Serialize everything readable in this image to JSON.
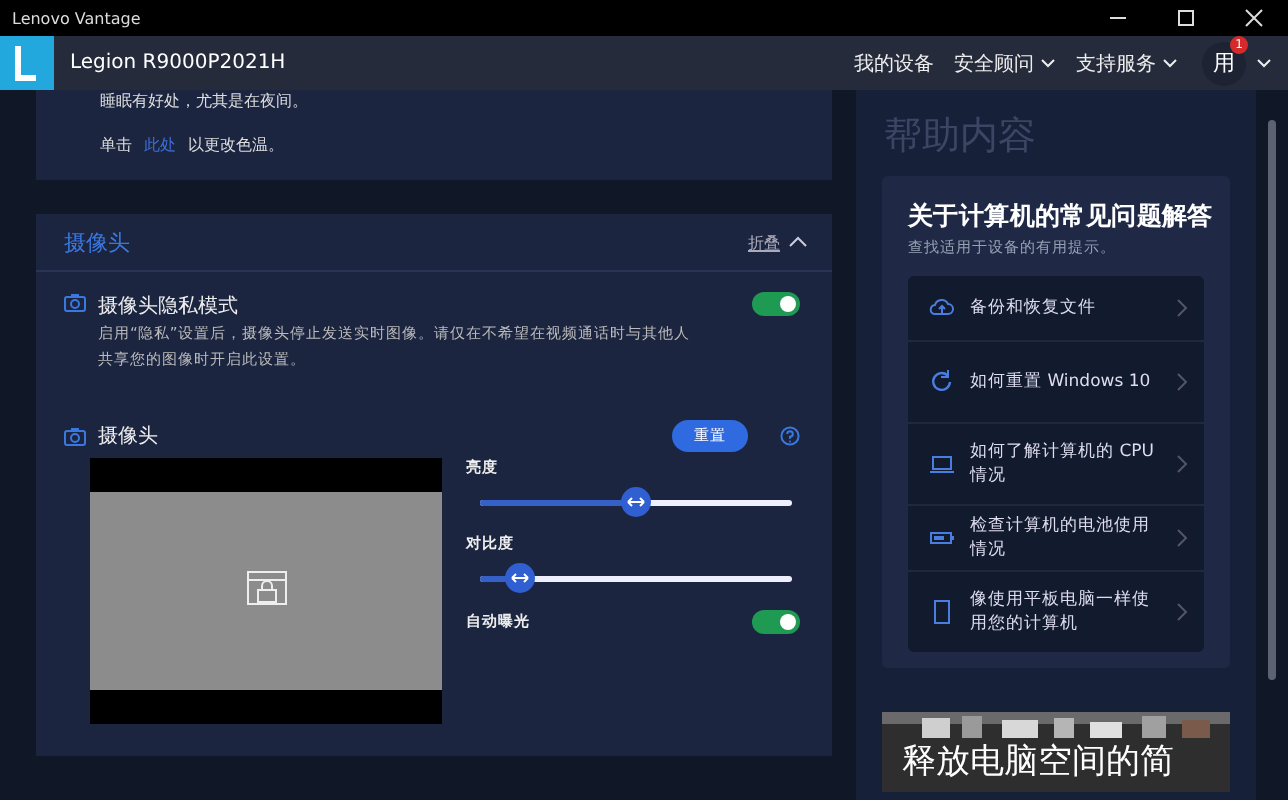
{
  "window": {
    "title": "Lenovo Vantage"
  },
  "header": {
    "device": "Legion R9000P2021H",
    "nav": [
      {
        "label": "我的设备",
        "dropdown": false
      },
      {
        "label": "安全顾问",
        "dropdown": true
      },
      {
        "label": "支持服务",
        "dropdown": true
      }
    ],
    "user": {
      "initial": "用",
      "badge": "1"
    }
  },
  "display_card": {
    "text": "睡眠有好处，尤其是在夜间。",
    "click_prefix": "单击",
    "link": "此处",
    "click_suffix": "以更改色温。"
  },
  "camera_card": {
    "title": "摄像头",
    "collapse": "折叠",
    "privacy": {
      "title": "摄像头隐私模式",
      "description": "启用“隐私”设置后，摄像头停止发送实时图像。请仅在不希望在视频通话时与其他人共享您的图像时开启此设置。",
      "on": true
    },
    "camera": {
      "title": "摄像头",
      "reset": "重置"
    },
    "sliders": [
      {
        "label": "亮度",
        "level": 0.5
      },
      {
        "label": "对比度",
        "level": 0.13
      }
    ],
    "auto_exposure": {
      "label": "自动曝光",
      "on": true
    }
  },
  "help": {
    "heading": "帮助内容",
    "title": "关于计算机的常见问题解答",
    "subtitle": "查找适用于设备的有用提示。",
    "items": [
      {
        "kind": "cloud",
        "label": "备份和恢复文件"
      },
      {
        "kind": "refresh",
        "label": "如何重置 Windows 10"
      },
      {
        "kind": "laptop",
        "label": "如何了解计算机的 CPU 情况"
      },
      {
        "kind": "battery",
        "label": "检查计算机的电池使用情况"
      },
      {
        "kind": "tablet",
        "label": "像使用平板电脑一样使用您的计算机"
      }
    ],
    "promo": {
      "kind": "picture",
      "title": "释放电脑空间的简"
    }
  }
}
